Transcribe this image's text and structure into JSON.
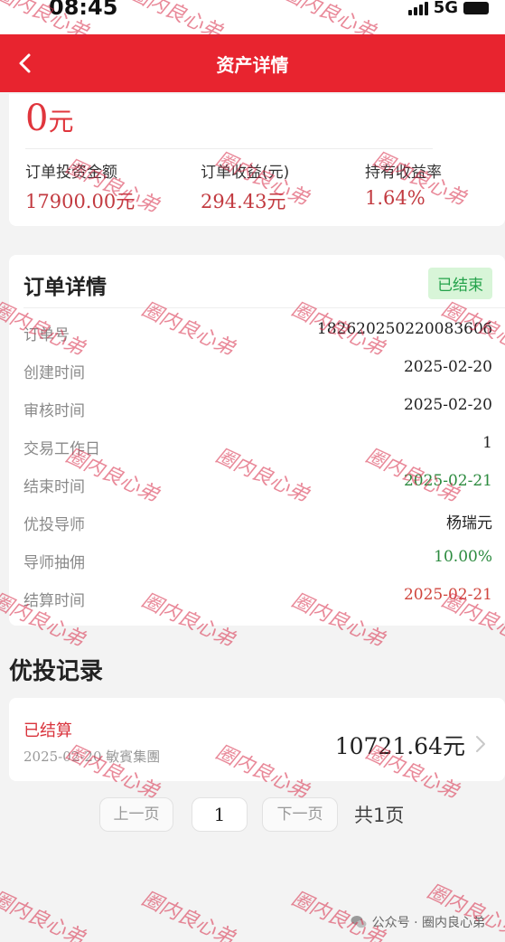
{
  "status_bar": {
    "time": "08:45",
    "network": "5G"
  },
  "header": {
    "title": "资产详情"
  },
  "summary": {
    "total_value": "0",
    "total_unit": "元",
    "stats": [
      {
        "label": "订单投资金额",
        "value": "17900.00元"
      },
      {
        "label": "订单收益(元)",
        "value": "294.43元"
      },
      {
        "label": "持有收益率",
        "value": "1.64%"
      }
    ]
  },
  "order_details": {
    "title": "订单详情",
    "status": "已结束",
    "rows": [
      {
        "label": "订单号",
        "value": "18262025022008360б"
      },
      {
        "label": "创建时间",
        "value": "2025-02-20"
      },
      {
        "label": "审核时间",
        "value": "2025-02-20"
      },
      {
        "label": "交易工作日",
        "value": "1"
      },
      {
        "label": "结束时间",
        "value": "2025-02-21"
      },
      {
        "label": "优投导师",
        "value": "杨瑞元"
      },
      {
        "label": "导师抽佣",
        "value": "10.00%"
      },
      {
        "label": "结算时间",
        "value": "2025-02-21"
      }
    ]
  },
  "records": {
    "title": "优投记录",
    "items": [
      {
        "status": "已结算",
        "date": "2025-02-20",
        "company": "敏賓集團",
        "amount": "10721.64元"
      }
    ]
  },
  "pagination": {
    "prev": "上一页",
    "current": "1",
    "next": "下一页",
    "total": "共1页"
  },
  "footer": {
    "source": "公众号 · 圈内良心弟"
  },
  "watermark_text": "圈内良心弟",
  "colors": {
    "brand_red": "#e8242f",
    "value_red": "#c23a40",
    "success_green": "#24a24a"
  }
}
